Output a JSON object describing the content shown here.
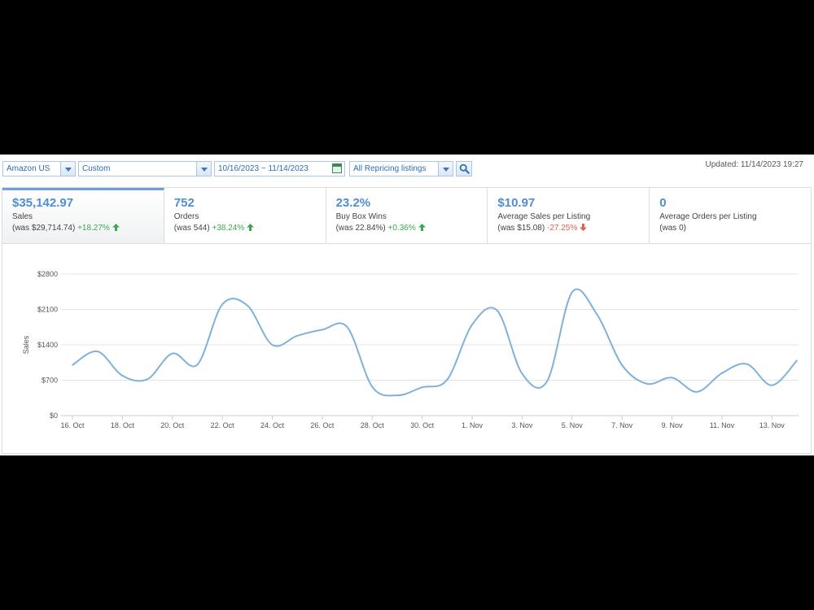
{
  "toolbar": {
    "marketplace": "Amazon US",
    "period": "Custom",
    "date_range": "10/16/2023 ~ 11/14/2023",
    "listing_filter": "All Repricing listings",
    "updated": "Updated: 11/14/2023 19:27"
  },
  "stats": [
    {
      "value": "$35,142.97",
      "label": "Sales",
      "prev": "(was $29,714.74)",
      "change": "+18.27%",
      "trend": "up"
    },
    {
      "value": "752",
      "label": "Orders",
      "prev": "(was 544)",
      "change": "+38.24%",
      "trend": "up"
    },
    {
      "value": "23.2%",
      "label": "Buy Box Wins",
      "prev": "(was 22.84%)",
      "change": "+0.36%",
      "trend": "up"
    },
    {
      "value": "$10.97",
      "label": "Average Sales per Listing",
      "prev": "(was $15.08)",
      "change": "-27.25%",
      "trend": "down"
    },
    {
      "value": "0",
      "label": "Average Orders per Listing",
      "prev": "(was 0)",
      "change": "",
      "trend": ""
    }
  ],
  "colors": {
    "line": "#7fb1db",
    "up": "#3ba84f",
    "down": "#e0604f",
    "accent": "#4f8ed1"
  },
  "chart_data": {
    "type": "line",
    "ylabel": "Sales",
    "ylim": [
      0,
      2800
    ],
    "yticks": [
      0,
      700,
      1400,
      2100,
      2800
    ],
    "ytick_labels": [
      "$0",
      "$700",
      "$1400",
      "$2100",
      "$2800"
    ],
    "xtick_labels": [
      "16. Oct",
      "18. Oct",
      "20. Oct",
      "22. Oct",
      "24. Oct",
      "26. Oct",
      "28. Oct",
      "30. Oct",
      "1. Nov",
      "3. Nov",
      "5. Nov",
      "7. Nov",
      "9. Nov",
      "11. Nov",
      "13. Nov"
    ],
    "x": [
      "10/16",
      "10/17",
      "10/18",
      "10/19",
      "10/20",
      "10/21",
      "10/22",
      "10/23",
      "10/24",
      "10/25",
      "10/26",
      "10/27",
      "10/28",
      "10/29",
      "10/30",
      "10/31",
      "11/01",
      "11/02",
      "11/03",
      "11/04",
      "11/05",
      "11/06",
      "11/07",
      "11/08",
      "11/09",
      "11/10",
      "11/11",
      "11/12",
      "11/13",
      "11/14"
    ],
    "values": [
      1000,
      1270,
      790,
      720,
      1230,
      1010,
      2200,
      2180,
      1400,
      1580,
      1700,
      1750,
      570,
      400,
      560,
      710,
      1800,
      2080,
      830,
      680,
      2440,
      2000,
      1000,
      630,
      750,
      470,
      840,
      1020,
      600,
      1090
    ],
    "grid": true
  }
}
